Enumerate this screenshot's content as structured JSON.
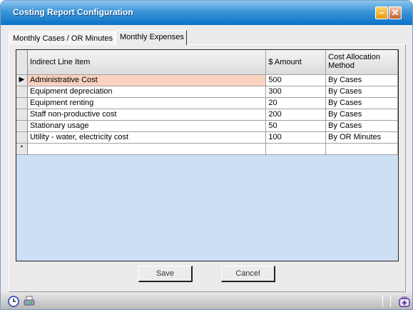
{
  "window": {
    "title": "Costing Report Configuration",
    "minimize_icon": "minimize-icon",
    "close_icon": "close-icon"
  },
  "tabs": [
    {
      "label": "Monthly Cases / OR Minutes",
      "active": false
    },
    {
      "label": "Monthly Expenses",
      "active": true
    }
  ],
  "grid": {
    "headers": [
      "Indirect Line Item",
      "$ Amount",
      "Cost Allocation Method"
    ],
    "rows": [
      {
        "item": "Administrative Cost",
        "amount": "500",
        "method": "By Cases"
      },
      {
        "item": "Equipment depreciation",
        "amount": "300",
        "method": "By Cases"
      },
      {
        "item": "Equipment renting",
        "amount": "20",
        "method": "By Cases"
      },
      {
        "item": "Staff non-productive cost",
        "amount": "200",
        "method": "By Cases"
      },
      {
        "item": "Stationary usage",
        "amount": "50",
        "method": "By Cases"
      },
      {
        "item": "Utility - water, electricity cost",
        "amount": "100",
        "method": "By OR Minutes"
      }
    ],
    "current_row_marker": "▶",
    "new_row_marker": "*",
    "selected_color": "#f9d2c0"
  },
  "buttons": {
    "save": "Save",
    "cancel": "Cancel"
  },
  "statusbar": {
    "icons": [
      "clock-icon",
      "printer-icon",
      "medical-bag-icon"
    ]
  }
}
